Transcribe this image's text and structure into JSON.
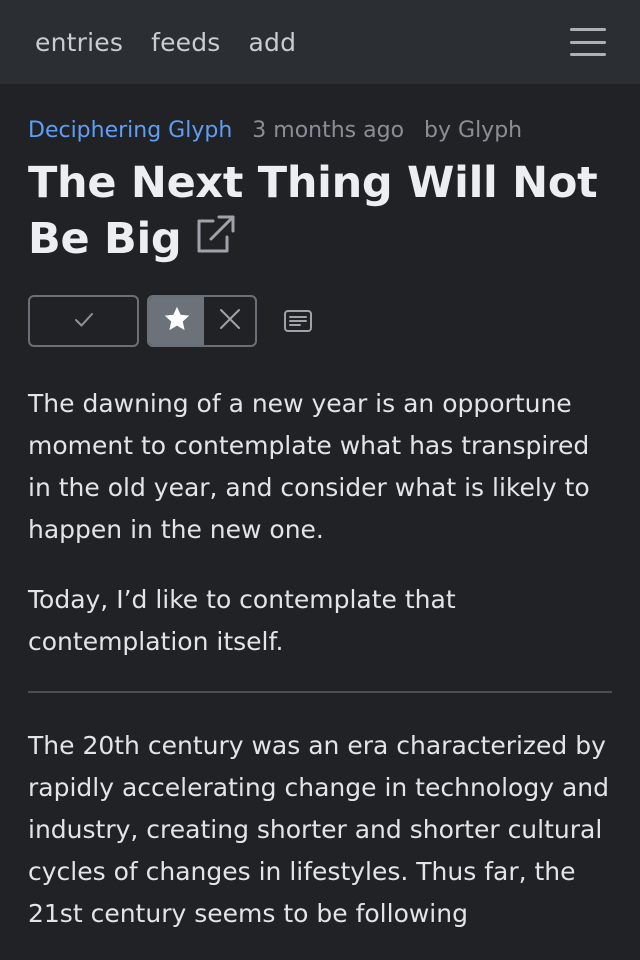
{
  "nav": {
    "entries": "entries",
    "feeds": "feeds",
    "add": "add"
  },
  "entry": {
    "feed_name": "Deciphering Glyph",
    "age": "3 months ago",
    "author": "by Glyph",
    "title": "The Next Thing Will Not Be Big",
    "paragraphs": [
      "The dawning of a new year is an opportune moment to contemplate what has transpired in the old year, and consider what is likely to happen in the new one.",
      "Today, I’d like to contemplate that contemplation itself.",
      "The 20th century was an era characterized by rapidly accelerating change in technology and industry, creating shorter and shorter cultural cycles of changes in lifestyles. Thus far, the 21st century seems to be following"
    ]
  },
  "icons": {
    "menu": "hamburger-icon",
    "external": "external-link-icon",
    "read": "check-icon",
    "star": "star-icon",
    "unstar": "x-icon",
    "notes": "notes-icon"
  },
  "colors": {
    "accent": "#5e9ef4",
    "background": "#202226",
    "topbar": "#2b2e33",
    "star_active": "#6c727a"
  }
}
